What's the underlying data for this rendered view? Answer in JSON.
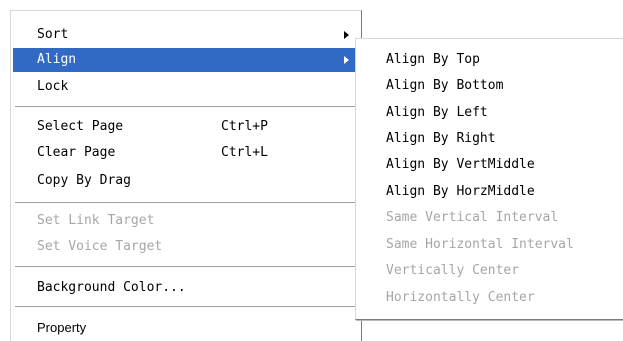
{
  "context_menu": {
    "sort": "Sort",
    "align": "Align",
    "lock": "Lock",
    "select_page": "Select Page",
    "select_page_shortcut": "Ctrl+P",
    "clear_page": "Clear Page",
    "clear_page_shortcut": "Ctrl+L",
    "copy_by_drag": "Copy By Drag",
    "set_link_target": "Set Link Target",
    "set_voice_target": "Set Voice Target",
    "background_color": "Background Color...",
    "property": "Property"
  },
  "align_submenu": {
    "align_by_top": "Align By Top",
    "align_by_bottom": "Align By Bottom",
    "align_by_left": "Align By Left",
    "align_by_right": "Align By Right",
    "align_by_vertmiddle": "Align By VertMiddle",
    "align_by_horzmiddle": "Align By HorzMiddle",
    "same_vertical_interval": "Same Vertical Interval",
    "same_horizontal_interval": "Same Horizontal Interval",
    "vertically_center": "Vertically Center",
    "horizontally_center": "Horizontally Center"
  },
  "colors": {
    "highlight": "#316ac5",
    "disabled_text": "#a6a6a6"
  }
}
